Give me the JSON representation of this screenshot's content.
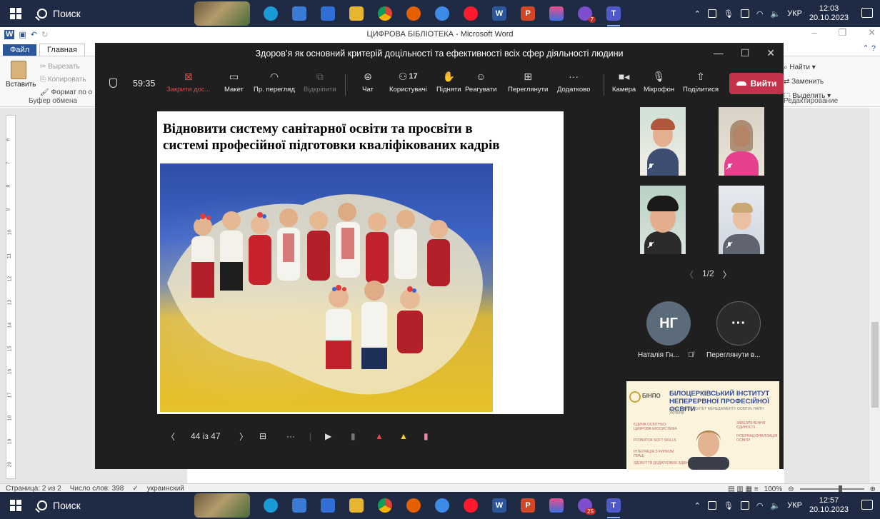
{
  "taskbar_top": {
    "search": "Поиск",
    "lang": "УКР",
    "time": "12:03",
    "date": "20.10.2023",
    "teams_badge": "7"
  },
  "taskbar_bottom": {
    "search": "Поиск",
    "lang": "УКР",
    "time": "12:57",
    "date": "20.10.2023",
    "teams_badge": "25"
  },
  "word": {
    "caption": "ЦИФРОВА БІБЛІОТЕКА  -  Microsoft Word",
    "tabs": {
      "file": "Файл",
      "home": "Главная"
    },
    "clipboard": {
      "paste": "Вставить",
      "cut": "Вырезать",
      "copy": "Копировать",
      "format": "Формат по о",
      "group": "Буфер обмена"
    },
    "editing": {
      "find": "Найти",
      "replace": "Заменить",
      "select": "Выделить",
      "group": "Редактирование"
    },
    "status": {
      "page": "Страница: 2 из 2",
      "words": "Число слов: 398",
      "lang": "украинский",
      "zoom": "100%"
    },
    "ruler_numbers": [
      "6",
      "7",
      "8",
      "9",
      "10",
      "11",
      "12",
      "13",
      "14",
      "15",
      "16",
      "17",
      "18",
      "19",
      "20"
    ]
  },
  "teams": {
    "title": "Здоров’я як основний критерій доцільності та ефективності всіх сфер діяльності людини",
    "timer": "59:35",
    "toolbar": {
      "close": "Закрити дос...",
      "layout": "Макет",
      "preview": "Пр. перегляд",
      "unpin": "Відкріпити",
      "chat": "Чат",
      "people": "Користувачі",
      "people_count": "17",
      "raise": "Підняти",
      "react": "Реагувати",
      "view": "Переглянути",
      "more": "Додатково",
      "camera": "Камера",
      "mic": "Мікрофон",
      "share": "Поділитися",
      "leave": "Вийти"
    },
    "slide": {
      "title_line1": "Відновити систему санітарної освіти та просвіти в",
      "title_line2": "системі професійної підготовки кваліфікованих кадрів"
    },
    "slide_nav": {
      "counter": "44 із 47"
    },
    "pager": "1/2",
    "avatars": {
      "ng_initials": "НГ",
      "ng_name": "Наталія Гн...",
      "more_label": "Переглянути в..."
    },
    "presenter": {
      "abbr": "БІНПО",
      "title": "БІЛОЦЕРКІВСЬКИЙ ІНСТИТУТ НЕПЕРЕРВНОЇ ПРОФЕСІЙНОЇ ОСВІТИ",
      "subtitle": "ДВНЗ «УНІВЕРСИТЕТ МЕНЕДЖМЕНТУ ОСВІТИ» НАПН УКРАЇНИ",
      "tags": [
        "ЄДИНА ОСВІТНЬО-ЦИФРОВА ЕКОСИСТЕМА",
        "РОЗВИТОК SOFT SKILLS",
        "ІНТЕГРАЦІЯ З РИНКОМ ПРАЦІ",
        "ЗДОБУТТЯ ДОДАТКОВИХ ЗДІБНОСТЕЙ",
        "ІНТЕРНАЦІОНАЛІЗАЦІЯ ОСВІТИ",
        "ЗАБЕЗПЕЧЕННЯ ЄДИНОСТІ"
      ]
    }
  }
}
